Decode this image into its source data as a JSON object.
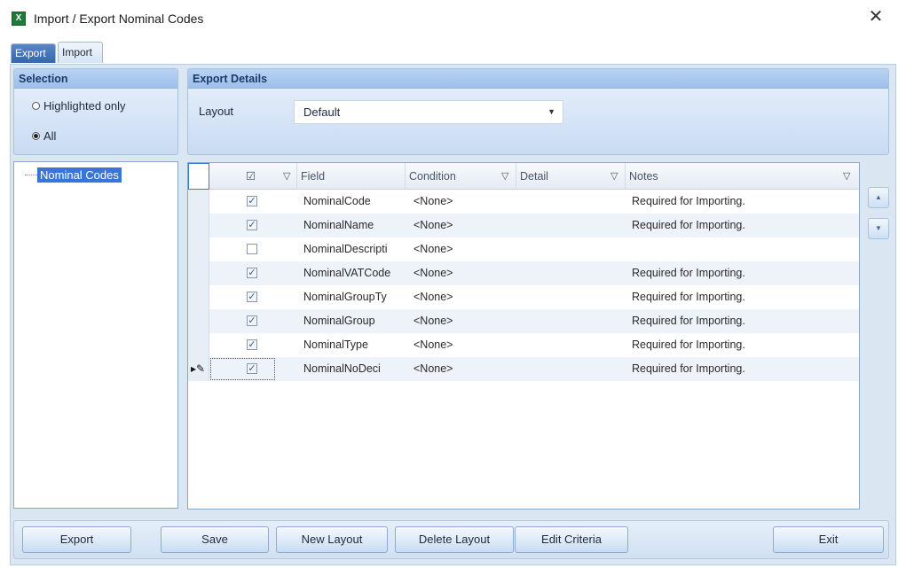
{
  "window": {
    "title": "Import / Export Nominal Codes",
    "icon": "excel-icon",
    "close_glyph": "✕"
  },
  "tabs": [
    {
      "label": "Export",
      "active": true
    },
    {
      "label": "Import",
      "active": false
    }
  ],
  "selection": {
    "header": "Selection",
    "options": [
      {
        "label": "Highlighted only",
        "selected": false
      },
      {
        "label": "All",
        "selected": true
      }
    ]
  },
  "export_details": {
    "header": "Export Details",
    "layout_label": "Layout",
    "layout_value": "Default"
  },
  "tree": {
    "items": [
      "Nominal Codes"
    ]
  },
  "grid": {
    "columns": {
      "check": "☑",
      "field": "Field",
      "condition": "Condition",
      "detail": "Detail",
      "notes": "Notes"
    },
    "rows": [
      {
        "checked": true,
        "field": "NominalCode",
        "condition": "<None>",
        "detail": "",
        "notes": "Required for Importing."
      },
      {
        "checked": true,
        "field": "NominalName",
        "condition": "<None>",
        "detail": "",
        "notes": "Required for Importing."
      },
      {
        "checked": false,
        "field": "NominalDescripti",
        "condition": "<None>",
        "detail": "",
        "notes": ""
      },
      {
        "checked": true,
        "field": "NominalVATCode",
        "condition": "<None>",
        "detail": "",
        "notes": "Required for Importing."
      },
      {
        "checked": true,
        "field": "NominalGroupTy",
        "condition": "<None>",
        "detail": "",
        "notes": "Required for Importing."
      },
      {
        "checked": true,
        "field": "NominalGroup",
        "condition": "<None>",
        "detail": "",
        "notes": "Required for Importing."
      },
      {
        "checked": true,
        "field": "NominalType",
        "condition": "<None>",
        "detail": "",
        "notes": "Required for Importing."
      },
      {
        "checked": true,
        "field": "NominalNoDeci",
        "condition": "<None>",
        "detail": "",
        "notes": "Required for Importing.",
        "editing": true
      }
    ]
  },
  "buttons": {
    "export": "Export",
    "save": "Save",
    "new_layout": "New Layout",
    "delete_layout": "Delete Layout",
    "edit_criteria": "Edit Criteria",
    "exit": "Exit"
  },
  "icons": {
    "move_up": "move-up-icon",
    "move_down": "move-down-icon",
    "filter": "filter-icon",
    "edit_pencil": "edit-pencil-icon"
  },
  "colors": {
    "accent": "#3875d7",
    "panel": "#dbe6f3",
    "header": "#9ebfe9"
  }
}
